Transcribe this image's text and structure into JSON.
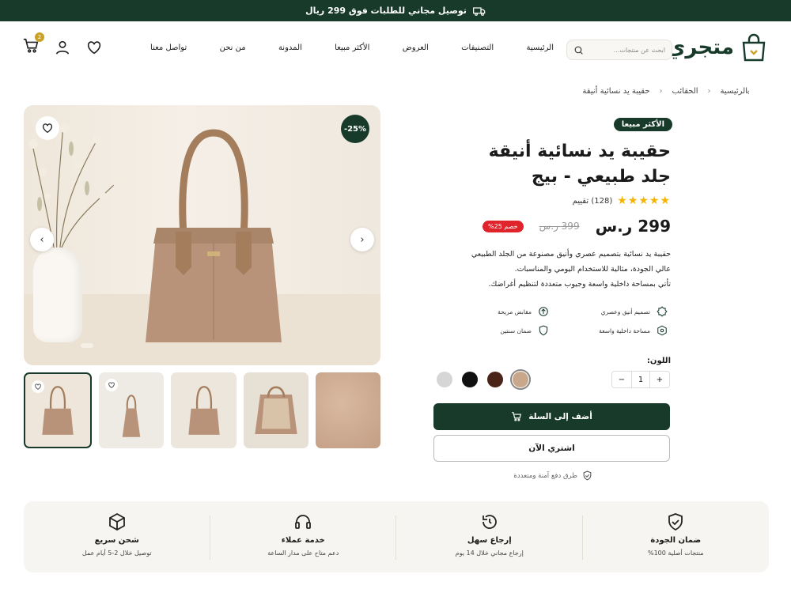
{
  "topbar": {
    "text": "توصيل مجاني للطلبات فوق 299 ريال",
    "icon": "truck-icon"
  },
  "header": {
    "logo": "متجري",
    "search_placeholder": "ابحث عن منتجات...",
    "nav": [
      "الرئيسية",
      "التصنيفات",
      "العروض",
      "الأكثر مبيعا",
      "المدونة",
      "من نحن",
      "تواصل معنا"
    ],
    "cart_count": "2"
  },
  "breadcrumb": [
    "الرئيسية",
    "الحقائب",
    "حقيبة يد نسائية أنيقة"
  ],
  "gallery": {
    "discount": "-25%"
  },
  "product": {
    "badge": "الأكثر مبيعا",
    "title_line1": "حقيبة يد نسائية أنيقة",
    "title_line2": "جلد طبيعي - بيج",
    "stars": "★★★★★",
    "rating_text": "(128) تقييم",
    "price": "299 ر.س",
    "old_price": "399 ر.س",
    "discount_label": "خصم 25%",
    "desc_lines": [
      "حقيبة يد نسائية بتصميم عصري وأنيق مصنوعة من الجلد الطبيعي",
      "عالي الجودة، مثالية للاستخدام اليومي والمناسبات.",
      "تأتي بمساحة داخلية واسعة وجيوب متعددة لتنظيم أغراضك."
    ],
    "features": [
      "تصميم أنيق وعصري",
      "مقابض مريحة",
      "مساحة داخلية واسعة",
      "ضمان سنتين"
    ],
    "features_display": [
      "تصميم أنيق وعصري",
      "مقابض مريحة",
      "مساحة داخلية واسعة",
      "ضمان سنتين"
    ],
    "color_label": "اللون:",
    "colors": [
      "#c8a78a",
      "#4a2416",
      "#111111",
      "#d6d6d6"
    ],
    "quantity": "1",
    "add_to_cart": "أضف إلى السلة",
    "buy_now": "اشتري الآن",
    "secure_text": "طرق دفع آمنة ومتعددة"
  },
  "perks": [
    {
      "title": "ضمان الجودة",
      "sub": "منتجات أصلية 100%",
      "icon": "shield-check-icon"
    },
    {
      "title": "إرجاع سهل",
      "sub": "إرجاع مجاني خلال 14 يوم",
      "icon": "return-icon"
    },
    {
      "title": "خدمة عملاء",
      "sub": "دعم متاح على مدار الساعة",
      "icon": "headset-icon"
    },
    {
      "title": "شحن سريع",
      "sub": "توصيل خلال 2-5 أيام عمل",
      "icon": "box-icon"
    }
  ]
}
